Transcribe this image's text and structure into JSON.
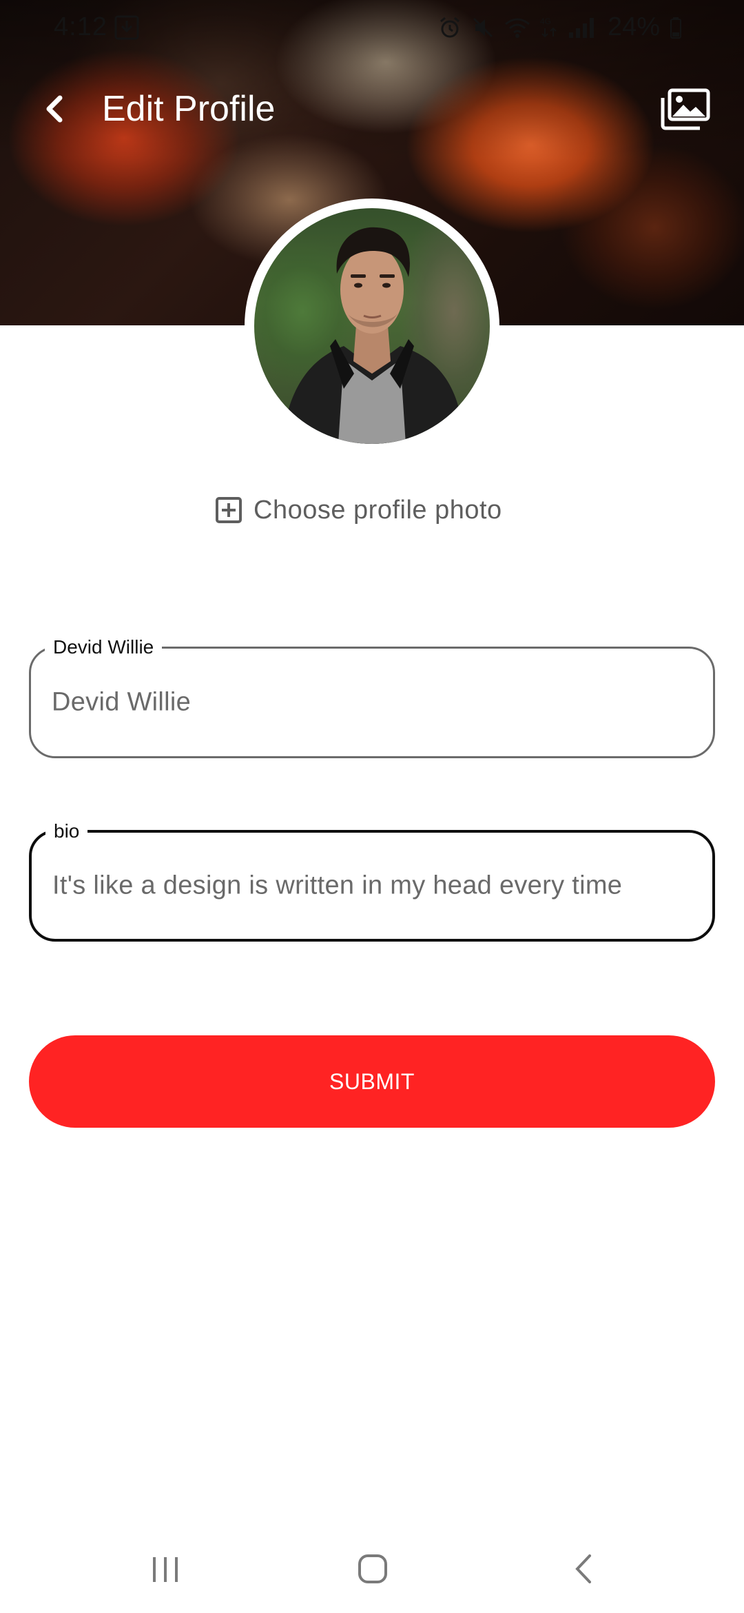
{
  "status_bar": {
    "time": "4:12",
    "battery": "24%",
    "icons": [
      "download-icon",
      "alarm-icon",
      "mute-icon",
      "wifi-icon",
      "4g-icon",
      "signal-icon",
      "battery-icon"
    ]
  },
  "header": {
    "title": "Edit Profile",
    "back_icon": "chevron-left-icon",
    "gallery_icon": "photo-gallery-icon"
  },
  "profile": {
    "choose_photo_label": "Choose profile photo",
    "choose_photo_icon": "add-box-icon"
  },
  "form": {
    "name_field": {
      "label": "Devid Willie",
      "value": "Devid Willie"
    },
    "bio_field": {
      "label": "bio",
      "value": "It's like a design is written in my head every time"
    },
    "submit_label": "SUBMIT"
  },
  "nav_bar": {
    "icons": [
      "recent-apps-icon",
      "home-icon",
      "back-icon"
    ]
  },
  "colors": {
    "accent": "#ff2323",
    "field_border": "#6b6b6b",
    "field_border_focused": "#0d0d0d",
    "text_muted": "#6a6a6a"
  }
}
